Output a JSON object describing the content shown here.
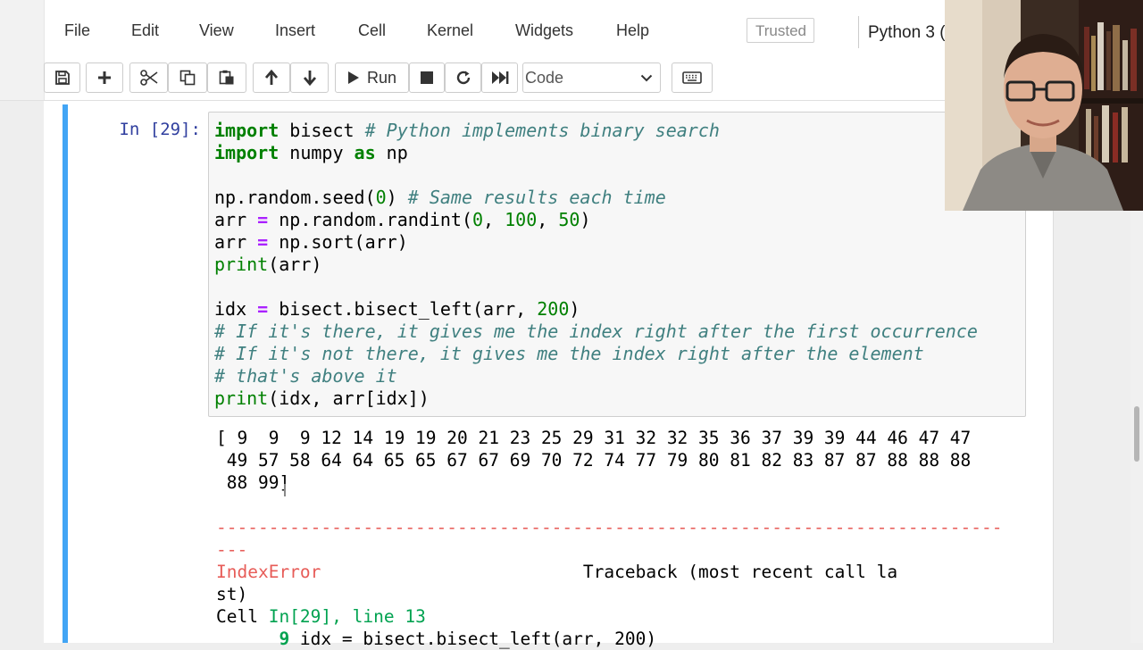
{
  "menu": {
    "items": [
      "File",
      "Edit",
      "View",
      "Insert",
      "Cell",
      "Kernel",
      "Widgets",
      "Help"
    ],
    "trusted": "Trusted",
    "kernel": "Python 3 ("
  },
  "toolbar": {
    "run_label": "Run",
    "cell_type": "Code",
    "icons": [
      "save-icon",
      "plus-icon",
      "scissors-icon",
      "copy-icon",
      "paste-icon",
      "arrow-up-icon",
      "arrow-down-icon",
      "play-icon",
      "stop-icon",
      "restart-icon",
      "fast-forward-icon",
      "keyboard-icon"
    ]
  },
  "cell": {
    "prompt": "In [29]:",
    "code_lines": [
      "import bisect # Python implements binary search",
      "import numpy as np",
      "",
      "np.random.seed(0) # Same results each time",
      "arr = np.random.randint(0, 100, 50)",
      "arr = np.sort(arr)",
      "print(arr)",
      "",
      "idx = bisect.bisect_left(arr, 200)",
      "# If it's there, it gives me the index right after the first occurrence",
      "# If it's not there, it gives me the index right after the element",
      "# that's above it",
      "print(idx, arr[idx])"
    ]
  },
  "output": {
    "stdout_lines": [
      "[ 9  9  9 12 14 19 19 20 21 23 25 29 31 32 32 35 36 37 39 39 44 46 47 47",
      " 49 57 58 64 64 65 65 67 67 69 70 72 74 77 79 80 81 82 83 87 87 88 88 88",
      " 88 99]"
    ],
    "error_dashes_1": "---------------------------------------------------------------------------",
    "error_dashes_2": "---",
    "error_name": "IndexError",
    "traceback_label": "                         Traceback (most recent call la",
    "traceback_wrap": "st)",
    "cell_prefix": "Cell ",
    "cell_ref": "In[29], line 13",
    "line_number": "      9 ",
    "line_code": "idx = bisect.bisect_left(arr, 200)"
  }
}
